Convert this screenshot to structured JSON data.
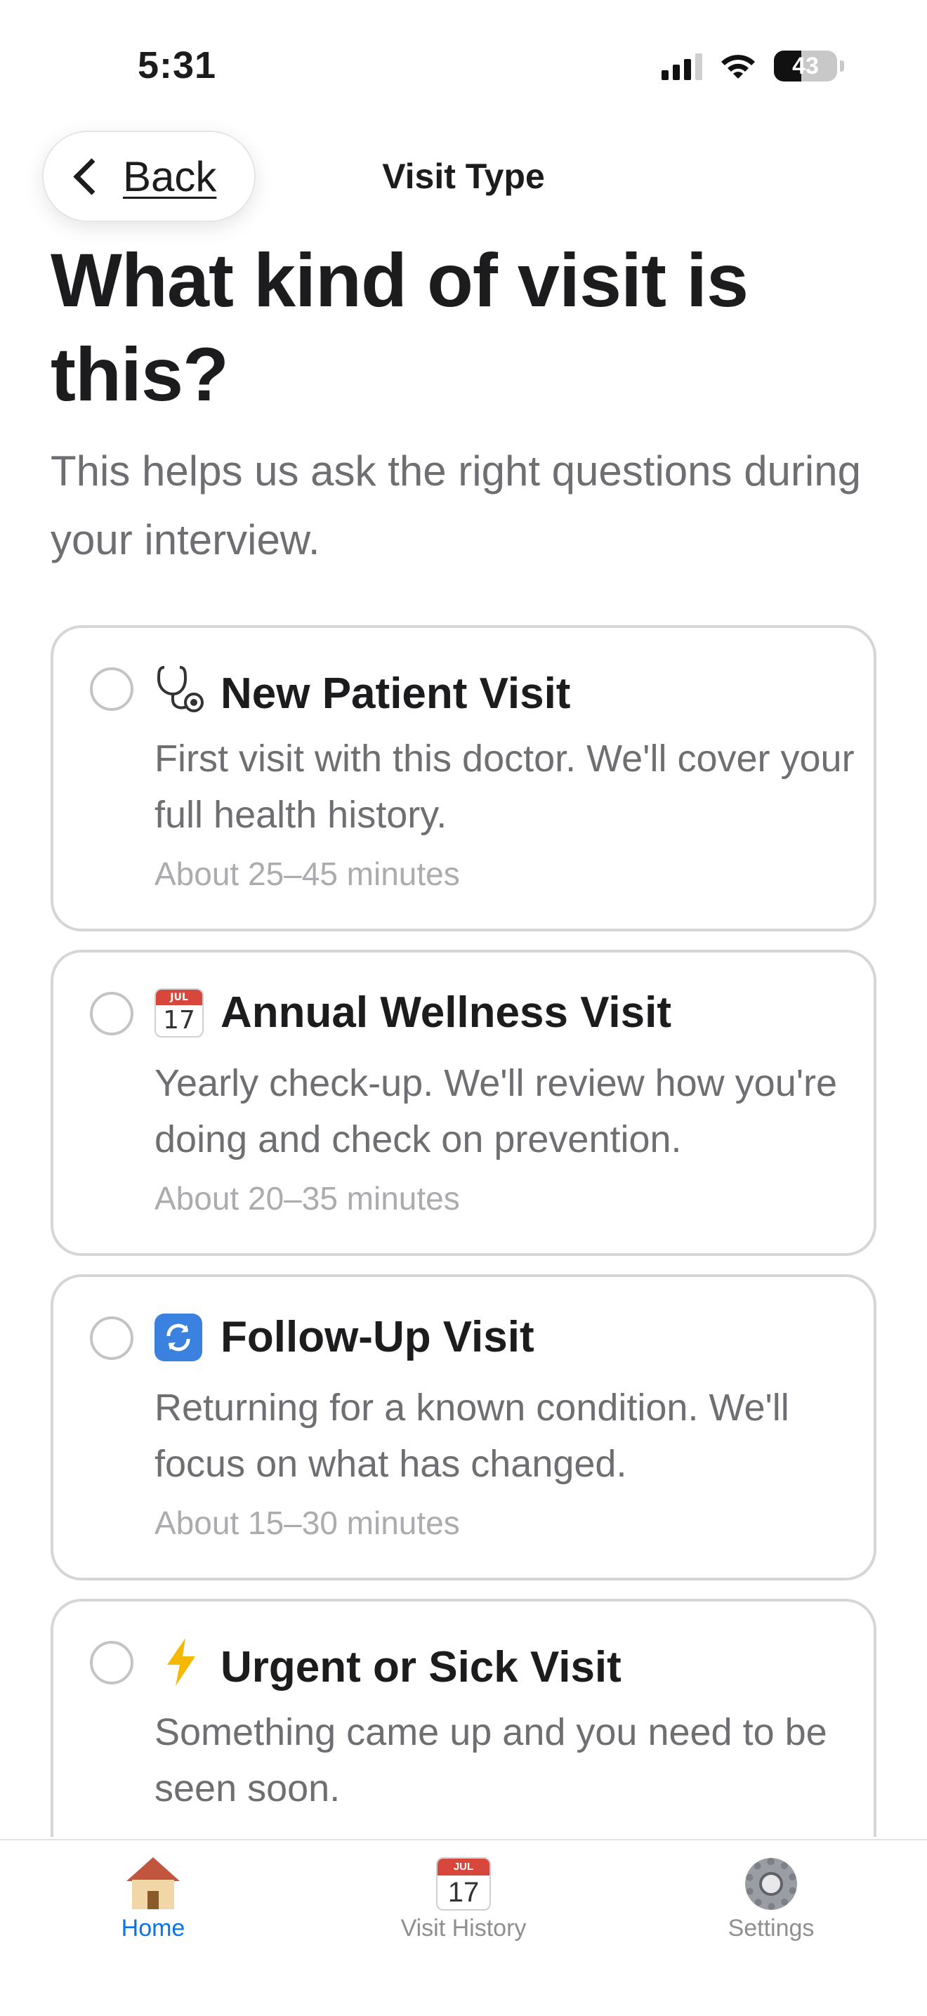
{
  "status_bar": {
    "time": "5:31",
    "battery_level": "43",
    "battery_fraction": 0.43
  },
  "nav": {
    "back_label": "Back",
    "title": "Visit Type"
  },
  "header": {
    "title": "What kind of visit is this?",
    "subtitle": "This helps us ask the right questions during your interview."
  },
  "options": [
    {
      "icon": "stethoscope-icon",
      "title": "New Patient Visit",
      "description": "First visit with this doctor. We'll cover your full health history.",
      "duration": "About 25–45 minutes",
      "selected": false
    },
    {
      "icon": "calendar-icon",
      "icon_month": "JUL",
      "icon_day": "17",
      "title": "Annual Wellness Visit",
      "description": "Yearly check-up. We'll review how you're doing and check on prevention.",
      "duration": "About 20–35 minutes",
      "selected": false
    },
    {
      "icon": "refresh-icon",
      "title": "Follow-Up Visit",
      "description": "Returning for a known condition. We'll focus on what has changed.",
      "duration": "About 15–30 minutes",
      "selected": false
    },
    {
      "icon": "lightning-icon",
      "title": "Urgent or Sick Visit",
      "description": "Something came up and you need to be seen soon.",
      "duration": "",
      "selected": false
    }
  ],
  "tab_bar": {
    "items": [
      {
        "label": "Home",
        "icon": "house-icon",
        "active": true
      },
      {
        "label": "Visit History",
        "icon": "calendar-icon",
        "icon_month": "JUL",
        "icon_day": "17",
        "active": false
      },
      {
        "label": "Settings",
        "icon": "gear-icon",
        "active": false
      }
    ]
  },
  "colors": {
    "accent": "#0a74e6",
    "secondary_text": "#6e6e73",
    "tertiary_text": "#ababb0",
    "card_border": "#d6d6d8"
  }
}
